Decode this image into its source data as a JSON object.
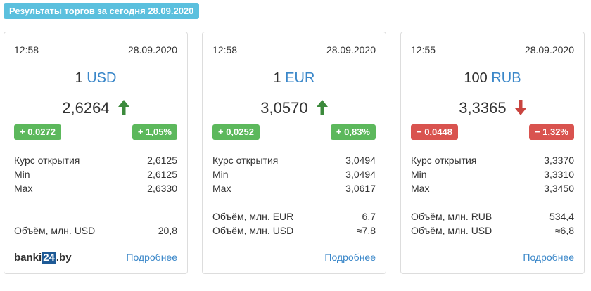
{
  "header": {
    "title": "Результаты торгов за сегодня 28.09.2020"
  },
  "colors": {
    "up": "#5cb85c",
    "down": "#d9534f",
    "accent": "#3a87c9",
    "title_bg": "#5bc0de"
  },
  "cards": [
    {
      "time": "12:58",
      "date": "28.09.2020",
      "amount": "1",
      "currency": "USD",
      "rate": "2,6264",
      "trend": "up",
      "trend_icon": "arrow-up-icon",
      "change_abs": "+ 0,0272",
      "change_pct": "+ 1,05%",
      "open_label": "Курс открытия",
      "open": "2,6125",
      "min_label": "Min",
      "min": "2,6125",
      "max_label": "Max",
      "max": "2,6330",
      "vol1_label": "Объём, млн. USD",
      "vol1": "20,8",
      "logo_left": "banki",
      "logo_box": "24",
      "logo_right": ".by",
      "more_label": "Подробнее"
    },
    {
      "time": "12:58",
      "date": "28.09.2020",
      "amount": "1",
      "currency": "EUR",
      "rate": "3,0570",
      "trend": "up",
      "trend_icon": "arrow-up-icon",
      "change_abs": "+ 0,0252",
      "change_pct": "+ 0,83%",
      "open_label": "Курс открытия",
      "open": "3,0494",
      "min_label": "Min",
      "min": "3,0494",
      "max_label": "Max",
      "max": "3,0617",
      "vol1_label": "Объём, млн. EUR",
      "vol1": "6,7",
      "vol2_label": "Объём, млн. USD",
      "vol2": "≈7,8",
      "more_label": "Подробнее"
    },
    {
      "time": "12:55",
      "date": "28.09.2020",
      "amount": "100",
      "currency": "RUB",
      "rate": "3,3365",
      "trend": "down",
      "trend_icon": "arrow-down-icon",
      "change_abs": "− 0,0448",
      "change_pct": "− 1,32%",
      "open_label": "Курс открытия",
      "open": "3,3370",
      "min_label": "Min",
      "min": "3,3310",
      "max_label": "Max",
      "max": "3,3450",
      "vol1_label": "Объём, млн. RUB",
      "vol1": "534,4",
      "vol2_label": "Объём, млн. USD",
      "vol2": "≈6,8",
      "more_label": "Подробнее"
    }
  ]
}
